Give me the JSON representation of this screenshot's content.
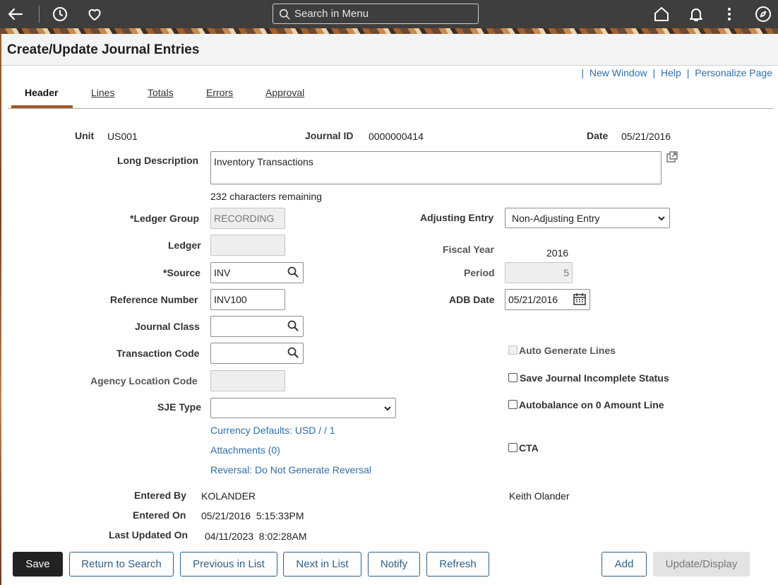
{
  "nav": {
    "search_placeholder": "Search in Menu"
  },
  "page": {
    "title": "Create/Update Journal Entries"
  },
  "toplinks": {
    "new_window": "New Window",
    "help": "Help",
    "personalize": "Personalize Page",
    "separator": "|"
  },
  "tabs": [
    {
      "label": "Header"
    },
    {
      "label": "Lines"
    },
    {
      "label": "Totals"
    },
    {
      "label": "Errors"
    },
    {
      "label": "Approval"
    }
  ],
  "form": {
    "unit_label": "Unit",
    "unit_value": "US001",
    "journal_id_label": "Journal ID",
    "journal_id_value": "0000000414",
    "date_label": "Date",
    "date_value": "05/21/2016",
    "long_desc_label": "Long Description",
    "long_desc_value": "Inventory Transactions",
    "chars_remaining": "232 characters remaining",
    "ledger_group_label": "*Ledger Group",
    "ledger_group_value": "RECORDING",
    "ledger_label": "Ledger",
    "ledger_value": "",
    "source_label": "*Source",
    "source_value": "INV",
    "reference_label": "Reference Number",
    "reference_value": "INV100",
    "journal_class_label": "Journal Class",
    "journal_class_value": "",
    "transaction_code_label": "Transaction Code",
    "transaction_code_value": "",
    "agency_location_label": "Agency Location Code",
    "agency_location_value": "",
    "sje_type_label": "SJE Type",
    "sje_type_value": "",
    "adjusting_entry_label": "Adjusting Entry",
    "adjusting_entry_value": "Non-Adjusting Entry",
    "fiscal_year_label": "Fiscal Year",
    "fiscal_year_value": "2016",
    "period_label": "Period",
    "period_value": "5",
    "adb_date_label": "ADB Date",
    "adb_date_value": "05/21/2016",
    "auto_generate_label": "Auto Generate Lines",
    "save_incomplete_label": "Save Journal Incomplete Status",
    "autobalance_label": "Autobalance on 0 Amount Line",
    "cta_label": "CTA",
    "currency_defaults_link": "Currency Defaults: USD / / 1",
    "attachments_link": "Attachments (0)",
    "reversal_link": "Reversal: Do Not Generate Reversal",
    "entered_by_label": "Entered By",
    "entered_by_value": "KOLANDER",
    "entered_by_name": "Keith Olander",
    "entered_on_label": "Entered On",
    "entered_on_value": "05/21/2016  5:15:33PM",
    "last_updated_label": "Last Updated On",
    "last_updated_value": "04/11/2023  8:02:28AM"
  },
  "buttons": {
    "save": "Save",
    "return_to_search": "Return to Search",
    "previous_in_list": "Previous in List",
    "next_in_list": "Next in List",
    "notify": "Notify",
    "refresh": "Refresh",
    "add": "Add",
    "update_display": "Update/Display"
  },
  "colors": {
    "header_bg": "#3f3e3c",
    "link": "#2e6ea8",
    "tab_accent": "#9d5b2c"
  }
}
